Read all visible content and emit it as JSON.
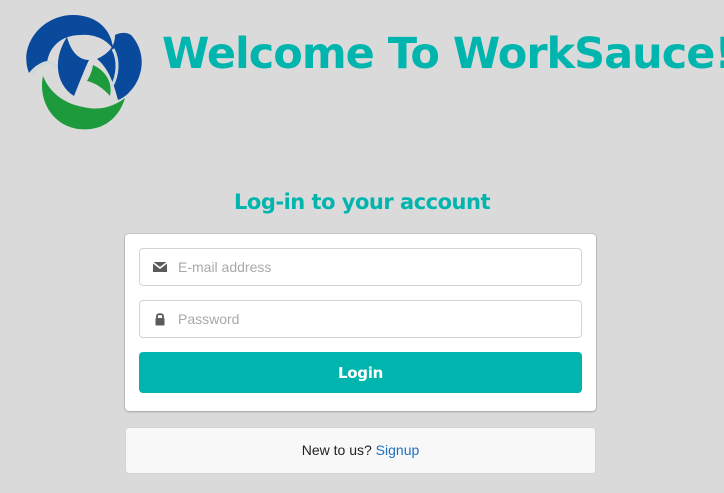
{
  "header": {
    "title": "Welcome To WorkSauce!",
    "logo_icon": "worksauce-swirl-logo"
  },
  "login_form": {
    "heading": "Log-in to your account",
    "email": {
      "icon": "envelope-icon",
      "placeholder": "E-mail address",
      "value": ""
    },
    "password": {
      "icon": "lock-icon",
      "placeholder": "Password",
      "value": ""
    },
    "submit_label": "Login"
  },
  "signup": {
    "prompt": "New to us?",
    "link_label": "Signup"
  },
  "colors": {
    "accent": "#00b5ad",
    "logo_blue": "#0a4a9c",
    "logo_green": "#1d9a3b",
    "link": "#1e70bf",
    "background": "#dadada"
  }
}
